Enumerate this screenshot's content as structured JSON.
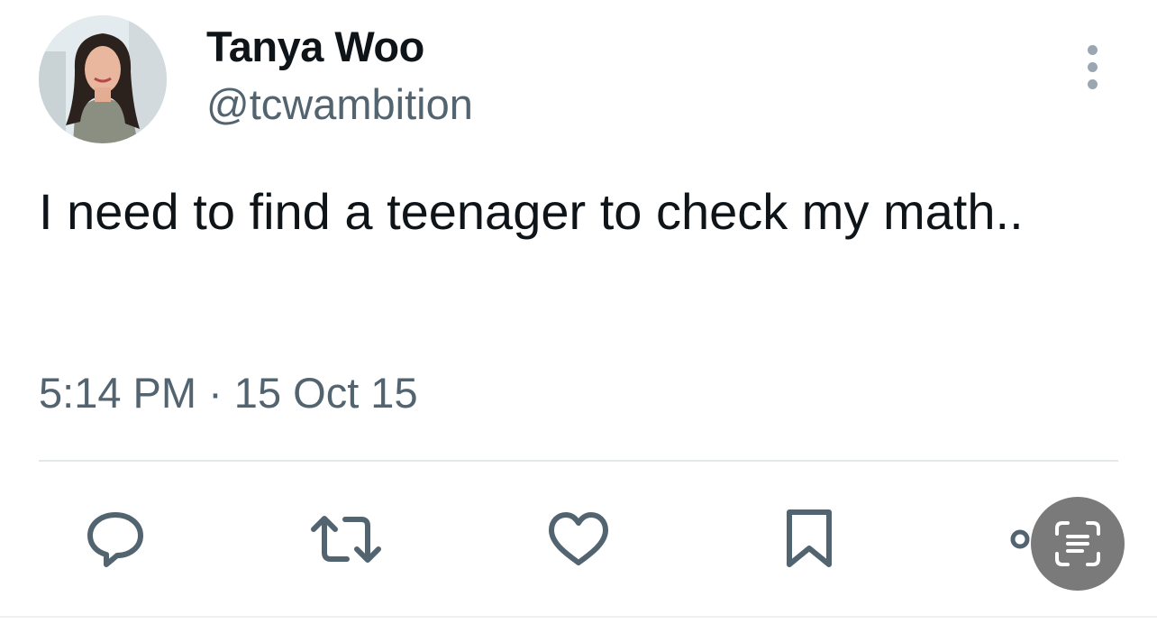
{
  "tweet": {
    "author": {
      "display_name": "Tanya Woo",
      "handle": "@tcwambition"
    },
    "text": "I need to find a teenager to check my math..",
    "timestamp": "5:14 PM · 15 Oct 15"
  },
  "actions": {
    "icons": [
      "reply-icon",
      "retweet-icon",
      "like-icon",
      "bookmark-icon",
      "share-icon"
    ],
    "icon_color": "#536471"
  },
  "overlay": {
    "icon": "text-scan-icon",
    "color": "#7a7a7a"
  },
  "colors": {
    "text_primary": "#0f1419",
    "text_secondary": "#536471",
    "divider": "#e3e8eb"
  }
}
